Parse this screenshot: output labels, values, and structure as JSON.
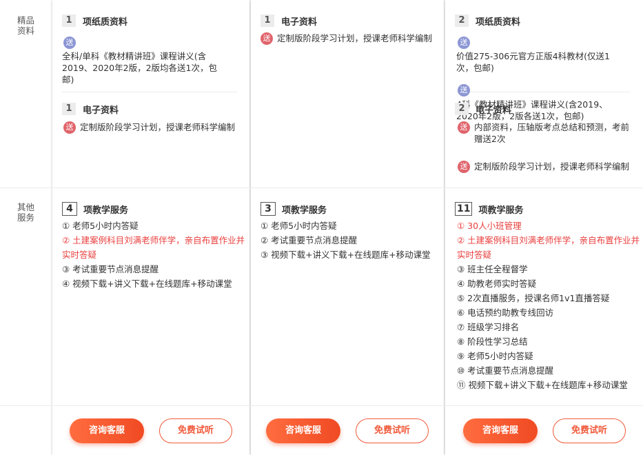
{
  "row_labels": {
    "materials": [
      "精品",
      "资料"
    ],
    "services": [
      "其他",
      "服务"
    ]
  },
  "gift_badge": "送",
  "colors": {
    "accent": "#f04a23",
    "red_text": "#e8403f",
    "badge_red": "#e0646c",
    "badge_blue": "#8c96d4"
  },
  "columns": [
    {
      "materials": {
        "paper": {
          "count": "1",
          "title": "项纸质资料",
          "items": [
            "全科/单科《教材精讲班》课程讲义(含2019、2020年2版，2版均各送1次，包邮)"
          ]
        },
        "electronic": {
          "count": "1",
          "title": "电子资料",
          "items": [
            "定制版阶段学习计划，授课老师科学编制"
          ]
        }
      },
      "services": {
        "count": "4",
        "title": "项教学服务",
        "items": [
          "① 老师5小时内答疑",
          "② 土建案例科目刘满老师伴学，亲自布置作业并实时答疑",
          "③ 考试重要节点消息提醒",
          "④ 视频下载+讲义下载+在线题库+移动课堂"
        ]
      },
      "buttons": {
        "consult": "咨询客服",
        "trial": "免费试听"
      }
    },
    {
      "materials": {
        "electronic": {
          "count": "1",
          "title": "电子资料",
          "items": [
            "定制版阶段学习计划，授课老师科学编制"
          ]
        }
      },
      "services": {
        "count": "3",
        "title": "项教学服务",
        "items": [
          "① 老师5小时内答疑",
          "② 考试重要节点消息提醒",
          "③ 视频下载+讲义下载+在线题库+移动课堂"
        ]
      },
      "buttons": {
        "consult": "咨询客服",
        "trial": "免费试听"
      }
    },
    {
      "materials": {
        "paper": {
          "count": "2",
          "title": "项纸质资料",
          "items": [
            "价值275-306元官方正版4科教材(仅送1次，包邮)",
            "4科《教材精讲班》课程讲义(含2019、2020年2版，2版各送1次，包邮)"
          ]
        },
        "electronic": {
          "count": "2",
          "title": "电子资料",
          "items": [
            "内部资料，压轴版考点总结和预测，考前赠送2次",
            "定制版阶段学习计划，授课老师科学编制"
          ]
        }
      },
      "services": {
        "count": "11",
        "title": "项教学服务",
        "items": [
          "① 30人小班管理",
          "② 土建案例科目刘满老师伴学，亲自布置作业并实时答疑",
          "③ 班主任全程督学",
          "④ 助教老师实时答疑",
          "⑤ 2次直播服务，授课名师1v1直播答疑",
          "⑥ 电话预约助教专线回访",
          "⑦ 班级学习排名",
          "⑧ 阶段性学习总结",
          "⑨ 老师5小时内答疑",
          "⑩ 考试重要节点消息提醒",
          "⑪ 视频下载+讲义下载+在线题库+移动课堂"
        ]
      },
      "buttons": {
        "consult": "咨询客服",
        "trial": "免费试听"
      }
    }
  ]
}
